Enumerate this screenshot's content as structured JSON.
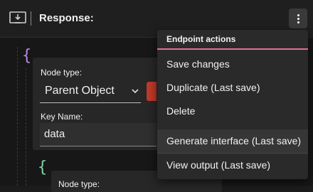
{
  "header": {
    "title": "Response:",
    "icon": "download-icon",
    "menu_icon": "more-vertical-icon"
  },
  "editor": {
    "open_brace": "{",
    "inner_brace": "{",
    "brace_colors": [
      "#b48ae0",
      "#7fd3a6"
    ]
  },
  "node_card": {
    "node_type_label": "Node type:",
    "node_type_value": "Parent Object",
    "key_name_label": "Key Name:",
    "key_name_value": "data"
  },
  "child_card": {
    "node_type_label": "Node type:"
  },
  "endpoint_menu": {
    "title": "Endpoint actions",
    "accent": "#e06f9a",
    "items": [
      {
        "label": "Save changes"
      },
      {
        "label": "Duplicate (Last save)"
      },
      {
        "label": "Delete"
      },
      {
        "label": "Generate interface (Last save)"
      },
      {
        "label": "View output (Last save)"
      }
    ]
  }
}
